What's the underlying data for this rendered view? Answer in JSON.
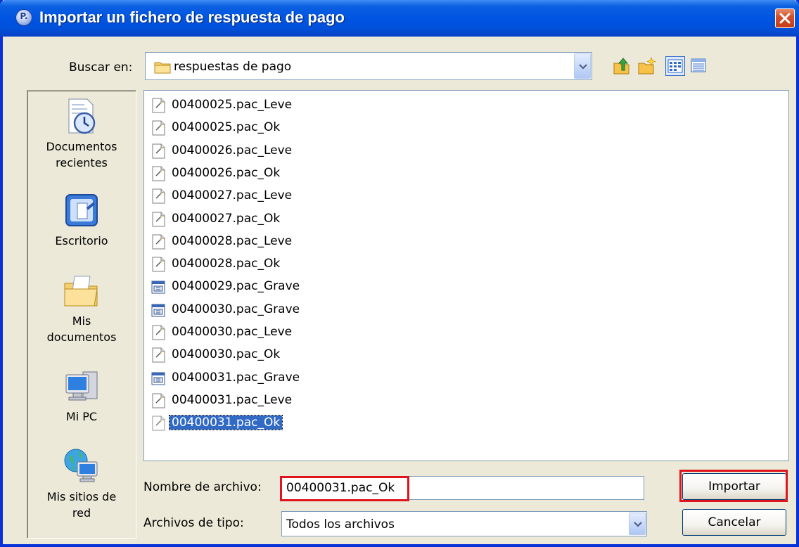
{
  "window": {
    "title": "Importar un fichero de respuesta de pago",
    "app_icon_letter": "P."
  },
  "toolbar": {
    "look_in_label": "Buscar en:",
    "look_in_value": "respuestas de pago",
    "buttons": [
      "up-folder-icon",
      "new-folder-icon",
      "list-view-icon",
      "details-view-icon"
    ]
  },
  "places": [
    {
      "label_line1": "Documentos",
      "label_line2": "recientes",
      "icon": "recent-documents-icon"
    },
    {
      "label_line1": "Escritorio",
      "label_line2": "",
      "icon": "desktop-icon"
    },
    {
      "label_line1": "Mis",
      "label_line2": "documentos",
      "icon": "my-documents-folder-icon"
    },
    {
      "label_line1": "Mi PC",
      "label_line2": "",
      "icon": "my-computer-icon"
    },
    {
      "label_line1": "Mis sitios de",
      "label_line2": "red",
      "icon": "network-places-icon"
    }
  ],
  "files": [
    {
      "name": "00400025.pac_Leve",
      "type": "text"
    },
    {
      "name": "00400025.pac_Ok",
      "type": "text"
    },
    {
      "name": "00400026.pac_Leve",
      "type": "text"
    },
    {
      "name": "00400026.pac_Ok",
      "type": "text"
    },
    {
      "name": "00400027.pac_Leve",
      "type": "text"
    },
    {
      "name": "00400027.pac_Ok",
      "type": "text"
    },
    {
      "name": "00400028.pac_Leve",
      "type": "text"
    },
    {
      "name": "00400028.pac_Ok",
      "type": "text"
    },
    {
      "name": "00400029.pac_Grave",
      "type": "app"
    },
    {
      "name": "00400030.pac_Grave",
      "type": "app"
    },
    {
      "name": "00400030.pac_Leve",
      "type": "text"
    },
    {
      "name": "00400030.pac_Ok",
      "type": "text"
    },
    {
      "name": "00400031.pac_Grave",
      "type": "app"
    },
    {
      "name": "00400031.pac_Leve",
      "type": "text"
    },
    {
      "name": "00400031.pac_Ok",
      "type": "text",
      "selected": true
    }
  ],
  "form": {
    "file_name_label": "Nombre de archivo:",
    "file_name_value": "00400031.pac_Ok",
    "file_type_label": "Archivos de tipo:",
    "file_type_value": "Todos los archivos"
  },
  "buttons": {
    "import_label": "Importar",
    "cancel_label": "Cancelar"
  },
  "colors": {
    "title_bar": "#0054e3",
    "selection": "#316ac5",
    "highlight_box": "#e0141c"
  }
}
